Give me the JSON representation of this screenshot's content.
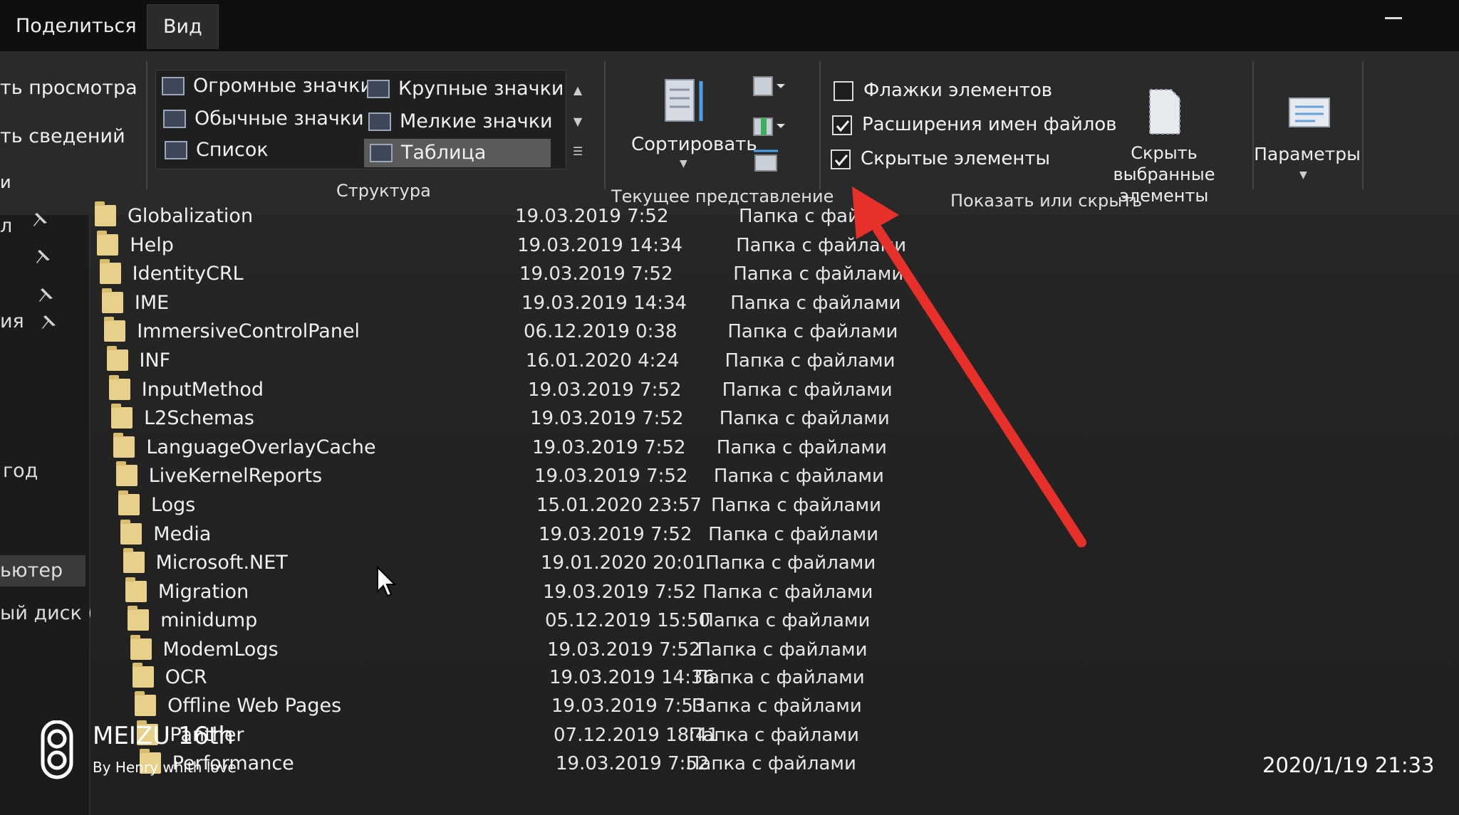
{
  "tabs": [
    {
      "label": "Поделиться"
    },
    {
      "label": "Вид",
      "active": true
    }
  ],
  "ribbon": {
    "panes": {
      "preview": "ть просмотра",
      "details": "ть сведений",
      "fragment": "и"
    },
    "layout": {
      "items": [
        "Огромные значки",
        "Крупные значки",
        "Обычные значки",
        "Мелкие значки",
        "Список",
        "Таблица"
      ],
      "selected": "Таблица",
      "group_label": "Структура"
    },
    "current_view": {
      "sort_label": "Сортировать",
      "group_label": "Текущее представление"
    },
    "show_hide": {
      "checkboxes": [
        {
          "label": "Флажки элементов",
          "checked": false
        },
        {
          "label": "Расширения имен файлов",
          "checked": true
        },
        {
          "label": "Скрытые элементы",
          "checked": true
        }
      ],
      "hide_selected_line1": "Скрыть выбранные",
      "hide_selected_line2": "элементы",
      "group_label": "Показать или скрыть"
    },
    "options_label": "Параметры"
  },
  "nav": {
    "items": [
      "л",
      "ия",
      "год",
      "ьютер",
      "ый диск (D:)"
    ]
  },
  "files": [
    {
      "name": "Globalization",
      "date": "19.03.2019 7:52",
      "type": "Папка с файла"
    },
    {
      "name": "Help",
      "date": "19.03.2019 14:34",
      "type": "Папка с файлами"
    },
    {
      "name": "IdentityCRL",
      "date": "19.03.2019 7:52",
      "type": "Папка с файлами"
    },
    {
      "name": "IME",
      "date": "19.03.2019 14:34",
      "type": "Папка с файлами"
    },
    {
      "name": "ImmersiveControlPanel",
      "date": "06.12.2019 0:38",
      "type": "Папка с файлами"
    },
    {
      "name": "INF",
      "date": "16.01.2020 4:24",
      "type": "Папка с файлами"
    },
    {
      "name": "InputMethod",
      "date": "19.03.2019 7:52",
      "type": "Папка с файлами"
    },
    {
      "name": "L2Schemas",
      "date": "19.03.2019 7:52",
      "type": "Папка с файлами"
    },
    {
      "name": "LanguageOverlayCache",
      "date": "19.03.2019 7:52",
      "type": "Папка с файлами"
    },
    {
      "name": "LiveKernelReports",
      "date": "19.03.2019 7:52",
      "type": "Папка с файлами"
    },
    {
      "name": "Logs",
      "date": "15.01.2020 23:57",
      "type": "Папка с файлами"
    },
    {
      "name": "Media",
      "date": "19.03.2019 7:52",
      "type": "Папка с файлами"
    },
    {
      "name": "Microsoft.NET",
      "date": "19.01.2020 20:01",
      "type": "Папка с файлами"
    },
    {
      "name": "Migration",
      "date": "19.03.2019 7:52",
      "type": "Папка с файлами"
    },
    {
      "name": "minidump",
      "date": "05.12.2019 15:50",
      "type": "Папка с файлами"
    },
    {
      "name": "ModemLogs",
      "date": "19.03.2019 7:52",
      "type": "Папка с файлами"
    },
    {
      "name": "OCR",
      "date": "19.03.2019 14:36",
      "type": "Папка с файлами"
    },
    {
      "name": "Offline Web Pages",
      "date": "19.03.2019 7:53",
      "type": "Папка с файлами"
    },
    {
      "name": "Panther",
      "date": "07.12.2019 18:41",
      "type": "Папка с файлами"
    },
    {
      "name": "Performance",
      "date": "19.03.2019 7:52",
      "type": "Папка с файлами"
    }
  ],
  "watermark": {
    "title": "MEIZU 16th",
    "subtitle": "By Henry whith love"
  },
  "timestamp": "2020/1/19  21:33",
  "colors": {
    "arrow": "#e8302a",
    "folder": "#e9d08a",
    "selected": "#5a5a5a"
  }
}
